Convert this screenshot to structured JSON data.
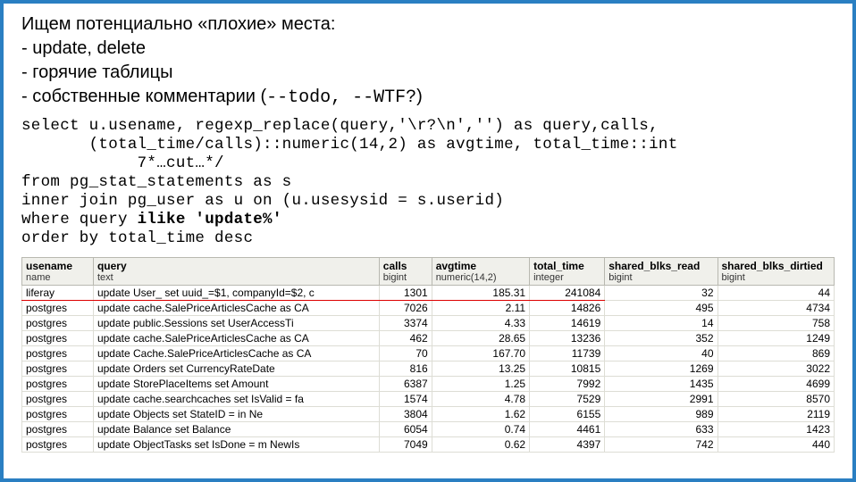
{
  "heading": {
    "title": "Ищем потенциально «плохие» места:",
    "bullet1": "- update, delete",
    "bullet2": "- горячие таблицы",
    "bullet3_pre": "- собственные комментарии (",
    "bullet3_code": "--todo,  --WTF?",
    "bullet3_post": ")"
  },
  "sql": {
    "line1": "select u.usename, regexp_replace(query,'\\r?\\n','') as query,calls,",
    "line2": "       (total_time/calls)::numeric(14,2) as avgtime, total_time::int",
    "line3": "            7*…cut…*/",
    "line4": "from pg_stat_statements as s",
    "line5": "inner join pg_user as u on (u.usesysid = s.userid)",
    "line6a": "where query ",
    "line6b": "ilike 'update%'",
    "line7": "order by total_time desc"
  },
  "table": {
    "headers": {
      "usename": {
        "top": "usename",
        "sub": "name"
      },
      "query": {
        "top": "query",
        "sub": "text"
      },
      "calls": {
        "top": "calls",
        "sub": "bigint"
      },
      "avgtime": {
        "top": "avgtime",
        "sub": "numeric(14,2)"
      },
      "total": {
        "top": "total_time",
        "sub": "integer"
      },
      "read": {
        "top": "shared_blks_read",
        "sub": "bigint"
      },
      "dirtied": {
        "top": "shared_blks_dirtied",
        "sub": "bigint"
      }
    },
    "rows": [
      {
        "hl": true,
        "u": "liferay",
        "q": "update User_ set uuid_=$1, companyId=$2, c",
        "c": "1301",
        "a": "185.31",
        "t": "241084",
        "r": "32",
        "d": "44"
      },
      {
        "hl": false,
        "u": "postgres",
        "q": "update cache.SalePriceArticlesCache as CA",
        "c": "7026",
        "a": "2.11",
        "t": "14826",
        "r": "495",
        "d": "4734"
      },
      {
        "hl": false,
        "u": "postgres",
        "q": "update public.Sessions   set UserAccessTi",
        "c": "3374",
        "a": "4.33",
        "t": "14619",
        "r": "14",
        "d": "758"
      },
      {
        "hl": false,
        "u": "postgres",
        "q": "update cache.SalePriceArticlesCache as CA",
        "c": "462",
        "a": "28.65",
        "t": "13236",
        "r": "352",
        "d": "1249"
      },
      {
        "hl": false,
        "u": "postgres",
        "q": "update Cache.SalePriceArticlesCache as CA",
        "c": "70",
        "a": "167.70",
        "t": "11739",
        "r": "40",
        "d": "869"
      },
      {
        "hl": false,
        "u": "postgres",
        "q": "update Orders   set CurrencyRateDate",
        "c": "816",
        "a": "13.25",
        "t": "10815",
        "r": "1269",
        "d": "3022"
      },
      {
        "hl": false,
        "u": "postgres",
        "q": "update StorePlaceItems    set Amount",
        "c": "6387",
        "a": "1.25",
        "t": "7992",
        "r": "1435",
        "d": "4699"
      },
      {
        "hl": false,
        "u": "postgres",
        "q": "update cache.searchcaches set IsValid = fa",
        "c": "1574",
        "a": "4.78",
        "t": "7529",
        "r": "2991",
        "d": "8570"
      },
      {
        "hl": false,
        "u": "postgres",
        "q": "update Objects    set StateID    = in Ne",
        "c": "3804",
        "a": "1.62",
        "t": "6155",
        "r": "989",
        "d": "2119"
      },
      {
        "hl": false,
        "u": "postgres",
        "q": "update Balance            set Balance",
        "c": "6054",
        "a": "0.74",
        "t": "4461",
        "r": "633",
        "d": "1423"
      },
      {
        "hl": false,
        "u": "postgres",
        "q": "update ObjectTasks    set IsDone = m NewIs",
        "c": "7049",
        "a": "0.62",
        "t": "4397",
        "r": "742",
        "d": "440"
      }
    ]
  }
}
